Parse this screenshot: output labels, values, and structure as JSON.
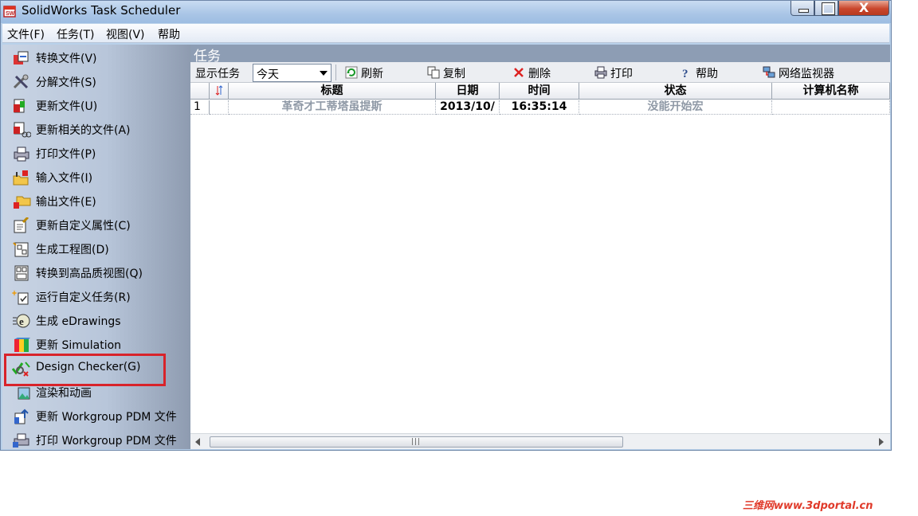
{
  "window": {
    "title": "SolidWorks Task Scheduler",
    "close_glyph": "X"
  },
  "menubar": {
    "items": [
      "文件(F)",
      "任务(T)",
      "视图(V)",
      "帮助"
    ]
  },
  "sidebar": {
    "items": [
      {
        "label": "转换文件(V)",
        "icon": "convert-files-icon"
      },
      {
        "label": "分解文件(S)",
        "icon": "tools-icon"
      },
      {
        "label": "更新文件(U)",
        "icon": "update-files-icon"
      },
      {
        "label": "更新相关的文件(A)",
        "icon": "update-related-icon"
      },
      {
        "label": "打印文件(P)",
        "icon": "printer-icon"
      },
      {
        "label": "输入文件(I)",
        "icon": "import-folder-icon"
      },
      {
        "label": "输出文件(E)",
        "icon": "export-folder-icon"
      },
      {
        "label": "更新自定义属性(C)",
        "icon": "custom-properties-icon"
      },
      {
        "label": "生成工程图(D)",
        "icon": "drawing-icon"
      },
      {
        "label": "转换到高品质视图(Q)",
        "icon": "high-quality-view-icon"
      },
      {
        "label": "运行自定义任务(R)",
        "icon": "custom-task-icon"
      },
      {
        "label": "生成 eDrawings",
        "icon": "edrawings-icon"
      },
      {
        "label": "更新 Simulation",
        "icon": "simulation-icon"
      },
      {
        "label": "Design Checker(G)",
        "icon": "design-checker-icon"
      },
      {
        "label": "渲染和动画",
        "icon": "render-icon"
      },
      {
        "label": "更新 Workgroup PDM 文件",
        "icon": "pdm-update-icon"
      },
      {
        "label": "打印 Workgroup PDM 文件",
        "icon": "pdm-print-icon"
      }
    ]
  },
  "pane": {
    "title": "任务",
    "show_label": "显示任务",
    "period_value": "今天",
    "toolbar": [
      {
        "label": "刷新",
        "icon": "refresh-icon"
      },
      {
        "label": "复制",
        "icon": "copy-icon"
      },
      {
        "label": "删除",
        "icon": "delete-icon"
      },
      {
        "label": "打印",
        "icon": "print-icon"
      },
      {
        "label": "帮助",
        "icon": "help-icon"
      },
      {
        "label": "网络监视器",
        "icon": "network-monitor-icon"
      }
    ]
  },
  "table": {
    "columns": [
      "",
      "",
      "标题",
      "日期",
      "时间",
      "状态",
      "计算机名称"
    ],
    "rows": [
      {
        "index": "1",
        "flag": "",
        "title": "革奇才工蒂塔虽提斯",
        "date": "2013/10/",
        "time": "16:35:14",
        "status": "没能开始宏",
        "computer": ""
      }
    ]
  },
  "scrollbar": {
    "grip": "|||"
  },
  "watermark": "三维网www.3dportal.cn",
  "colors": {
    "highlight": "#d8232a",
    "pane_header": "#8d9db4",
    "accent": "#9dbde2"
  }
}
